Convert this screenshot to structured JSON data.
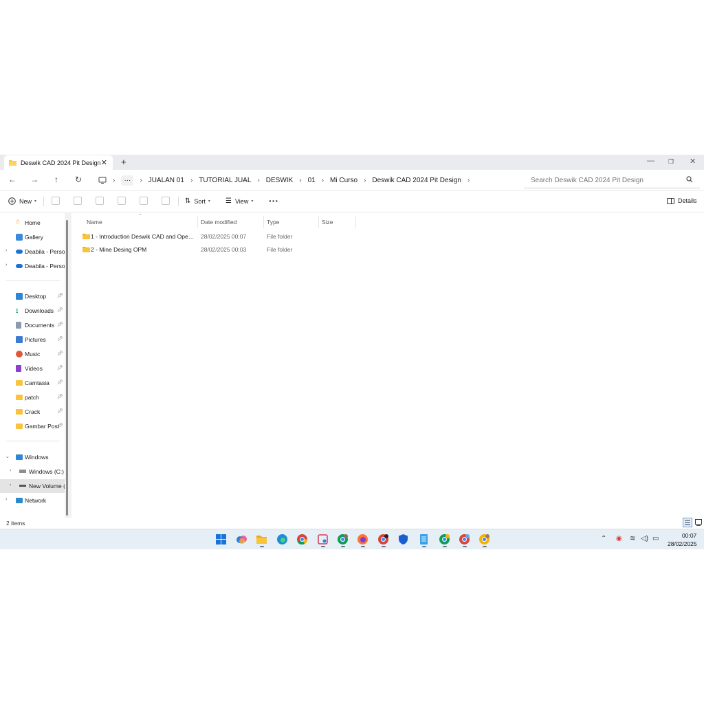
{
  "window": {
    "tab_title": "Deswik CAD 2024 Pit Design",
    "new_tab": "+",
    "close_tab": "✕"
  },
  "address": {
    "more": "···",
    "crumbs": [
      "JUALAN 01",
      "TUTORIAL JUAL",
      "DESWIK",
      "01",
      "Mi Curso",
      "Deswik CAD 2024 Pit Design"
    ],
    "search_placeholder": "Search Deswik CAD 2024 Pit Design"
  },
  "toolbar": {
    "new_label": "New",
    "sort_label": "Sort",
    "view_label": "View",
    "more_label": "···",
    "details_label": "Details"
  },
  "sidebar": {
    "top": [
      {
        "label": "Home",
        "icon": "home-icon"
      },
      {
        "label": "Gallery",
        "icon": "gallery-icon"
      },
      {
        "label": "Deabila - Persor",
        "icon": "onedrive-icon"
      },
      {
        "label": "Deabila - Persor",
        "icon": "onedrive-icon"
      }
    ],
    "pinned": [
      {
        "label": "Desktop",
        "icon": "desktop-icon"
      },
      {
        "label": "Downloads",
        "icon": "downloads-icon"
      },
      {
        "label": "Documents",
        "icon": "documents-icon"
      },
      {
        "label": "Pictures",
        "icon": "pictures-icon"
      },
      {
        "label": "Music",
        "icon": "music-icon"
      },
      {
        "label": "Videos",
        "icon": "videos-icon"
      },
      {
        "label": "Camtasia",
        "icon": "folder-icon"
      },
      {
        "label": "patch",
        "icon": "folder-icon"
      },
      {
        "label": "Crack",
        "icon": "folder-icon"
      },
      {
        "label": "Gambar Post",
        "icon": "folder-icon"
      }
    ],
    "drives": [
      {
        "label": "Windows",
        "icon": "pc-icon"
      },
      {
        "label": "Windows (C:)",
        "icon": "drive-icon"
      },
      {
        "label": "New Volume (I",
        "icon": "drive-icon"
      },
      {
        "label": "Network",
        "icon": "network-icon"
      }
    ]
  },
  "columns": {
    "name": "Name",
    "date": "Date modified",
    "type": "Type",
    "size": "Size"
  },
  "files": [
    {
      "name": "1 - Introduction Deswik CAD and Open Pi...",
      "date": "28/02/2025 00:07",
      "type": "File folder",
      "size": ""
    },
    {
      "name": "2 - Mine Desing OPM",
      "date": "28/02/2025 00:03",
      "type": "File folder",
      "size": ""
    }
  ],
  "status": {
    "item_count": "2 items"
  },
  "taskbar": {
    "time": "00:07",
    "date": "28/02/2025"
  },
  "colors": {
    "folder": "#f8c43c",
    "accent": "#0067c0",
    "taskbar_bg": "#e6eef6"
  }
}
